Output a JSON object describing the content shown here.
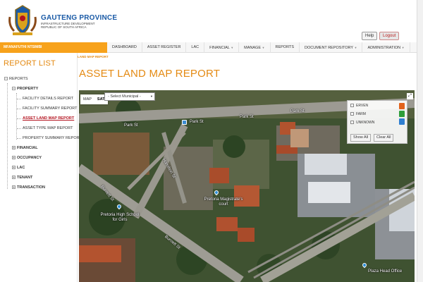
{
  "header": {
    "brand_title": "GAUTENG PROVINCE",
    "brand_sub1": "INFRASTRUCTURE DEVELOPMENT",
    "brand_sub2": "REPUBLIC OF SOUTH AFRICA",
    "help_label": "Help",
    "logout_label": "Logout"
  },
  "user": {
    "name": "MFANAFUTHI NTSIMBI"
  },
  "nav": {
    "items": [
      "DASHBOARD",
      "ASSET REGISTER",
      "LAC",
      "FINANCIAL",
      "MANAGE",
      "REPORTS",
      "DOCUMENT REPOSITORY",
      "ADMINISTRATION"
    ]
  },
  "sidebar": {
    "title": "REPORT LIST",
    "root": "REPORTS",
    "property": "PROPERTY",
    "property_children": [
      "FACILITY DETAILS REPORT",
      "FACILITY SUMMARY REPORT",
      "ASSET LAND MAP REPORT",
      "ASSET TYPE MAP REPORT",
      "PROPERTY SUMMARY REPORT"
    ],
    "others": [
      "FINANCIAL",
      "OCCUPANCY",
      "LAC",
      "TENANT",
      "TRANSACTION"
    ]
  },
  "breadcrumb": "LAND MAP REPORT",
  "page_title": "ASSET LAND MAP REPORT",
  "map": {
    "type_map": "MAP",
    "type_sat": "SAT",
    "select_placeholder": "- Select Municipal -",
    "legend": {
      "items": [
        "ERVEN",
        "FARM",
        "UNKNOWN"
      ],
      "show_all": "Show All",
      "clear_all": "Clear All",
      "icon_colors": [
        "#e2631c",
        "#2e9e3a",
        "#2f7fd0"
      ]
    },
    "labels": {
      "park1": "Park St",
      "park2": "Park St",
      "park3": "Park St",
      "park4": "Park St",
      "burnett1": "Burnett St",
      "burnett2": "Burnett St",
      "hamilton": "Hamilton St",
      "magistrate": "Pretoria Magistrate's court",
      "school": "Pretoria High School for Girls",
      "plaza": "Plaza Head Office"
    }
  }
}
